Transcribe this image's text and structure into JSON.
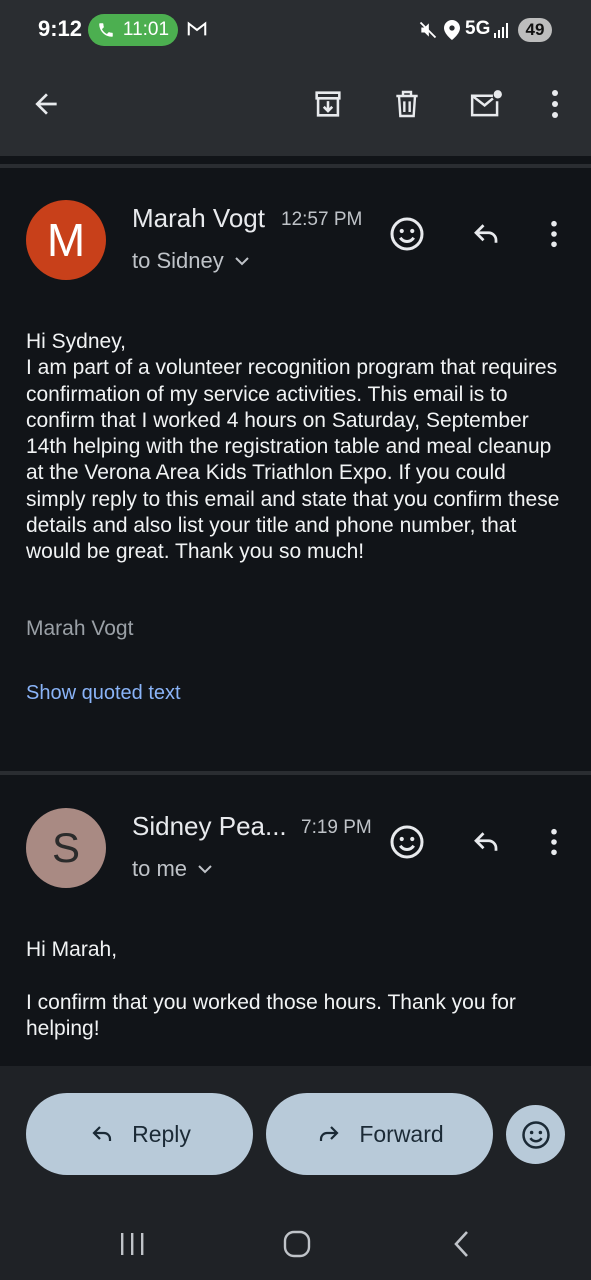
{
  "status_bar": {
    "time": "9:12",
    "call_duration": "11:01",
    "network": "5G",
    "battery": "49"
  },
  "app_bar": {
    "icons": [
      "back-arrow-icon",
      "archive-icon",
      "trash-icon",
      "mark-unread-icon",
      "more-vert-icon"
    ]
  },
  "messages": [
    {
      "avatar_letter": "M",
      "avatar_color": "#c8401a",
      "sender": "Marah Vogt",
      "time": "12:57 PM",
      "recipient": "to Sidney",
      "body": "Hi Sydney,\nI am part of a volunteer recognition program that requires confirmation of my service activities. This email is to confirm that I worked 4 hours on Saturday, September 14th helping with the registration table and meal cleanup at the Verona Area Kids Triathlon Expo. If you could simply reply to this email and state that you confirm these details and also list your title and phone number, that would be great. Thank you so much!",
      "signature": "Marah Vogt",
      "show_quoted": "Show quoted text"
    },
    {
      "avatar_letter": "S",
      "avatar_color": "#a98a83",
      "sender": "Sidney Pea...",
      "time": "7:19 PM",
      "recipient": "to me",
      "body": "Hi Marah,\n\nI confirm that you worked those hours. Thank you for helping!"
    }
  ],
  "actions": {
    "reply": "Reply",
    "forward": "Forward"
  },
  "colors": {
    "background": "#111418",
    "bar": "#2a2d31",
    "pill": "#b8cad9",
    "link": "#8ab4f8",
    "accent_green": "#4caf50"
  }
}
